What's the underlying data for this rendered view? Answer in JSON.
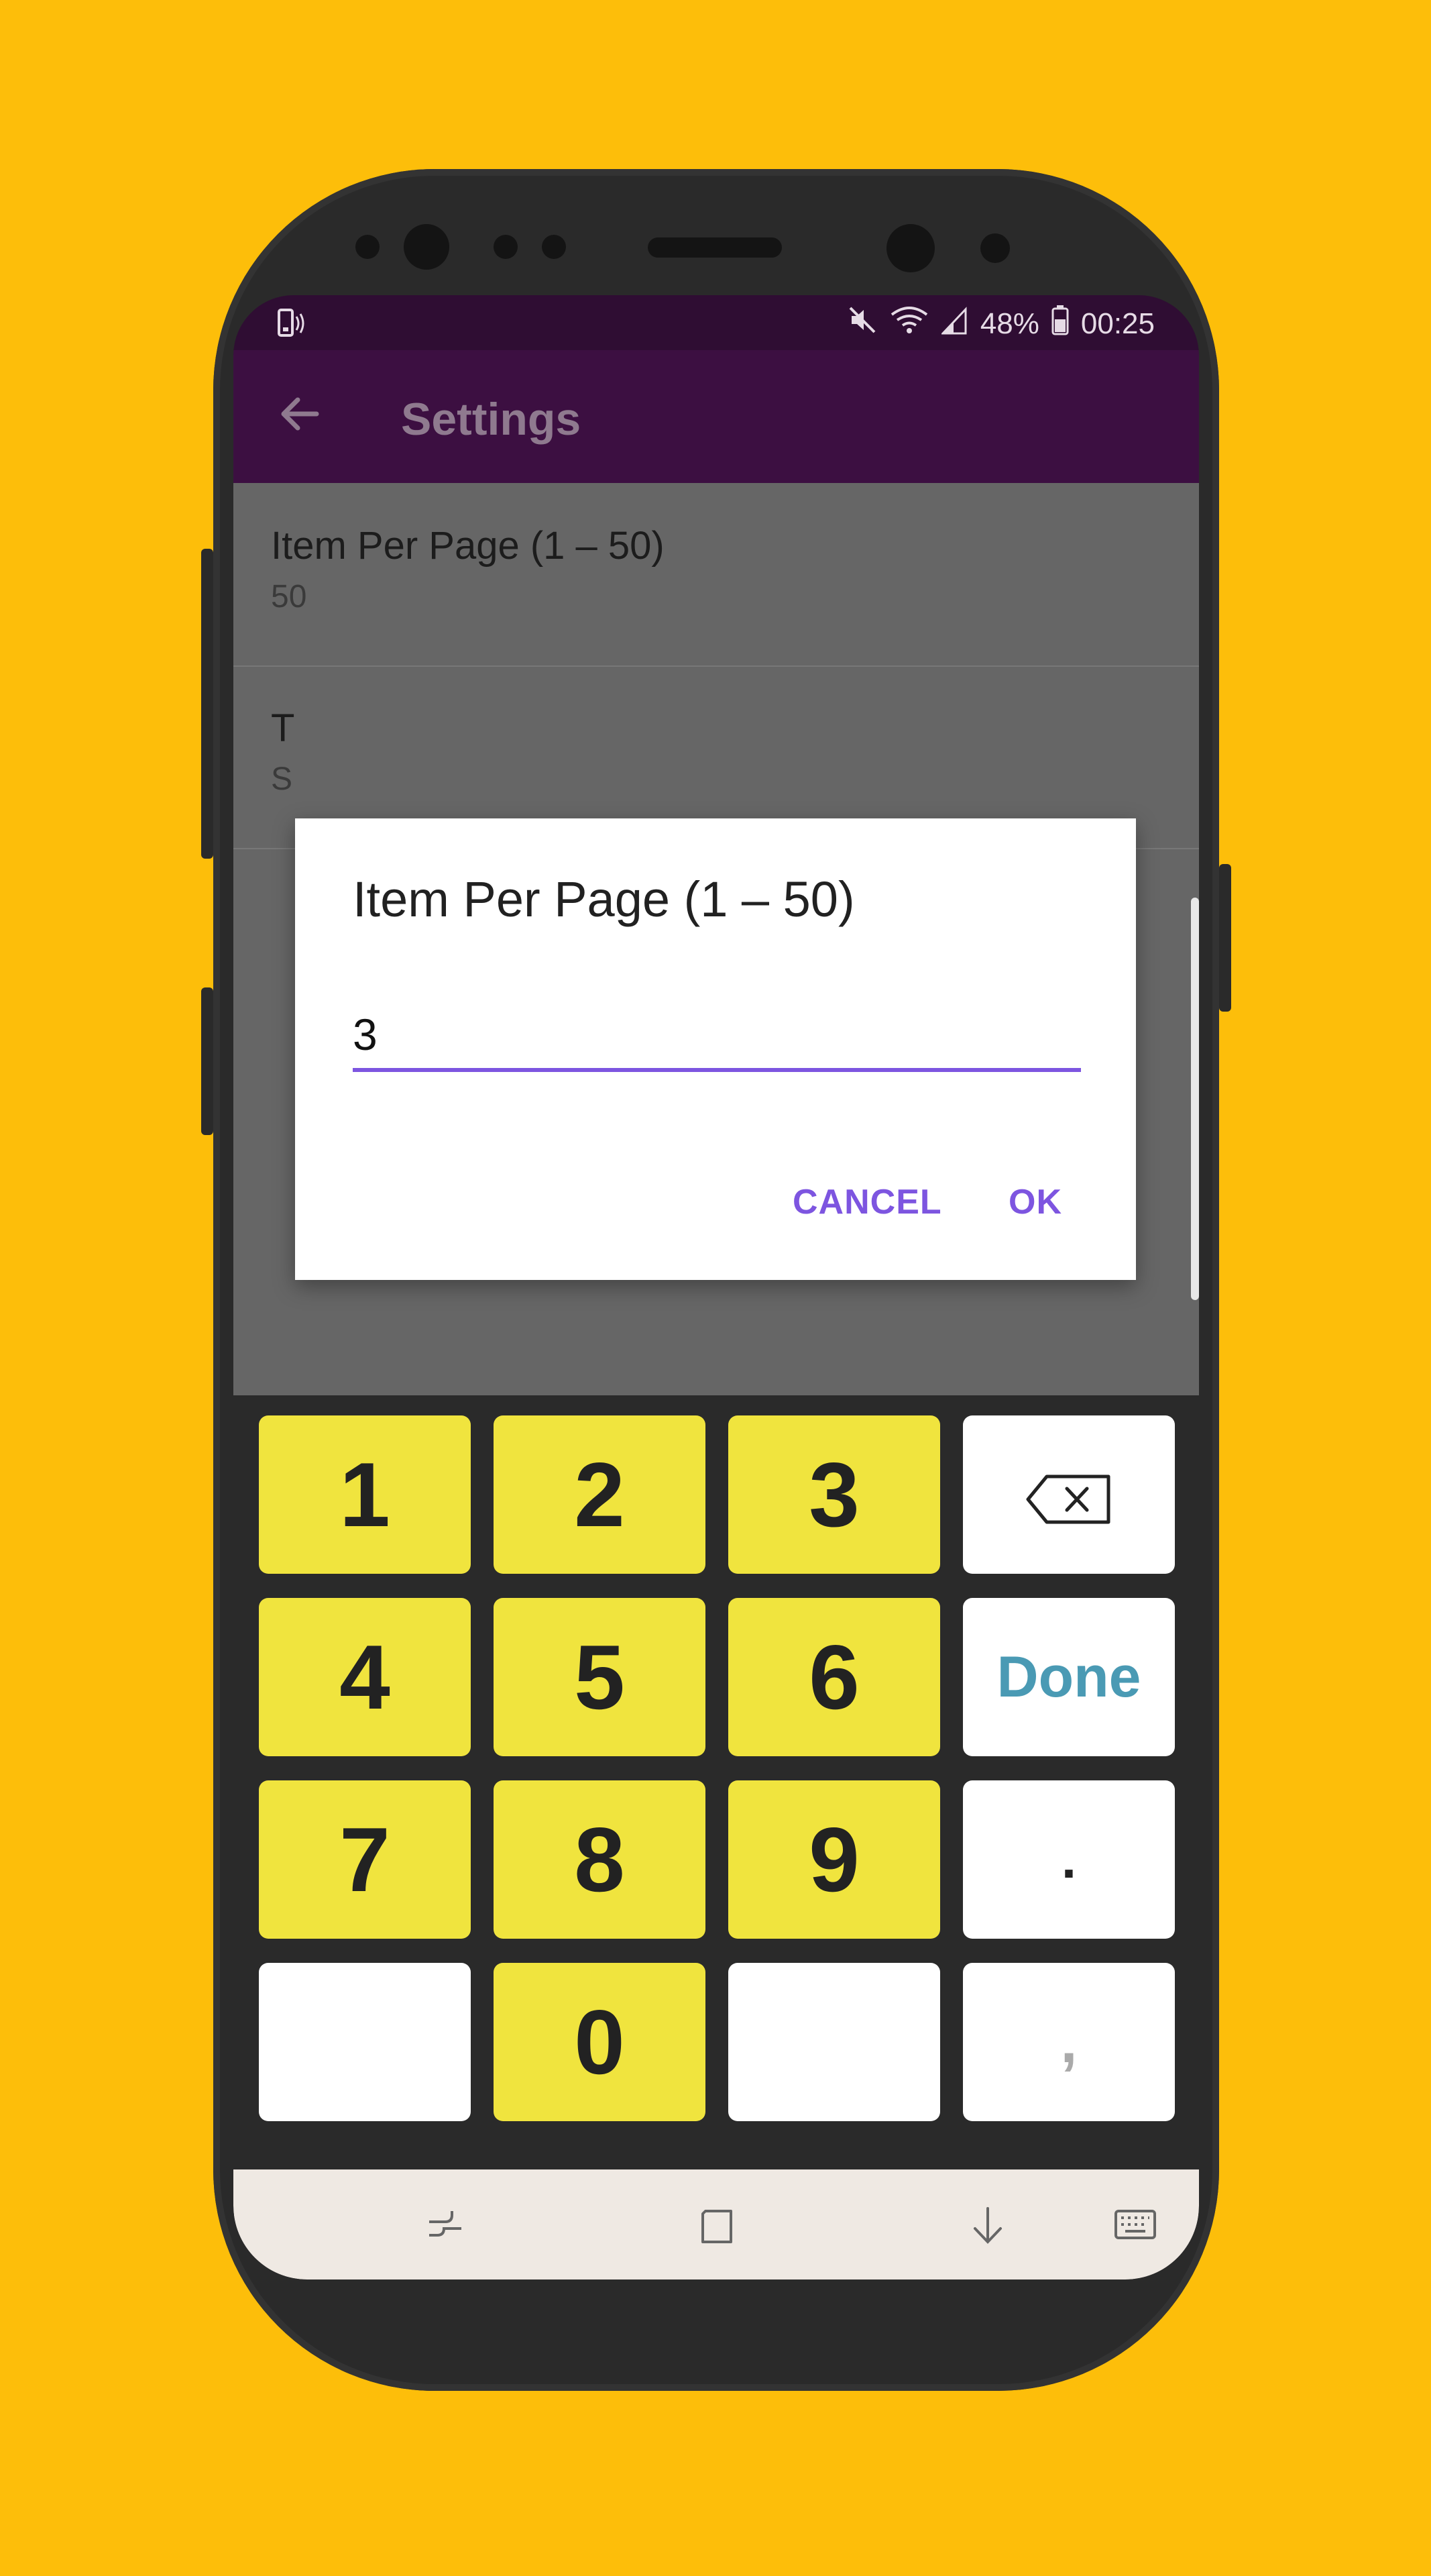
{
  "status_bar": {
    "battery": "48%",
    "time": "00:25",
    "icons": [
      "phone-vibrate-icon",
      "mute-icon",
      "wifi-icon",
      "signal-icon",
      "battery-icon"
    ]
  },
  "app_bar": {
    "title": "Settings",
    "back_icon": "arrow-back-icon"
  },
  "preferences": [
    {
      "title": "Item Per Page (1 – 50)",
      "summary": "50"
    },
    {
      "title": "T",
      "summary": "S"
    }
  ],
  "dialog": {
    "title": "Item Per Page (1 – 50)",
    "value": "3",
    "cancel_label": "CANCEL",
    "ok_label": "OK",
    "accent": "#7d55e0"
  },
  "keypad": {
    "keys": [
      [
        "1",
        "2",
        "3",
        "backspace"
      ],
      [
        "4",
        "5",
        "6",
        "Done"
      ],
      [
        "7",
        "8",
        "9",
        "."
      ],
      [
        "",
        "0",
        "",
        ","
      ]
    ],
    "digit_color": "#f0e43e",
    "done_color": "#4a9ab4"
  },
  "nav_bar": {
    "icons": [
      "recents-icon",
      "home-icon",
      "hide-keyboard-icon",
      "keyboard-icon"
    ]
  },
  "colors": {
    "background": "#FDBE0A",
    "app_bar": "#3c0f41",
    "status_bar": "#2f0d33"
  }
}
